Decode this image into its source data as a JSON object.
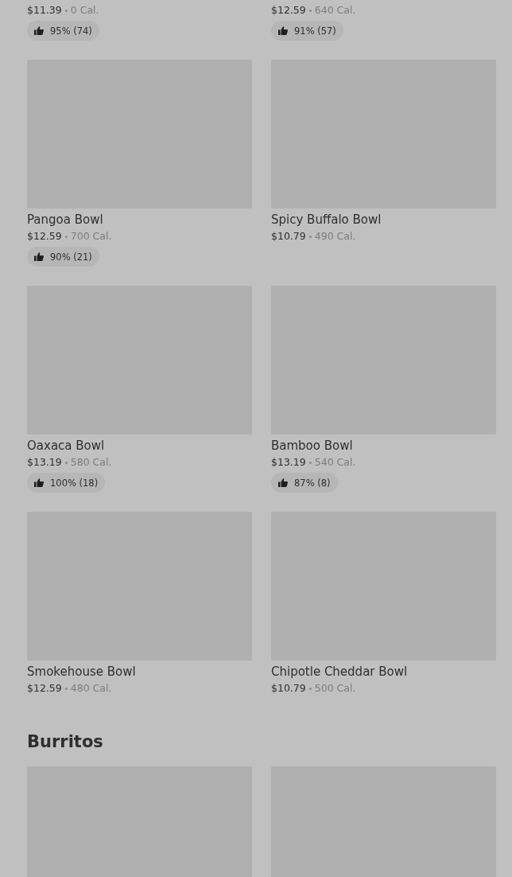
{
  "sections": [
    {
      "items": [
        {
          "image": false,
          "price": "$11.39",
          "calories": "0 Cal.",
          "rating": "95% (74)"
        },
        {
          "image": false,
          "price": "$12.59",
          "calories": "640 Cal.",
          "rating": "91% (57)"
        },
        {
          "image": true,
          "name": "Pangoa Bowl",
          "price": "$12.59",
          "calories": "700 Cal.",
          "rating": "90% (21)"
        },
        {
          "image": true,
          "name": "Spicy Buffalo Bowl",
          "price": "$10.79",
          "calories": "490 Cal."
        },
        {
          "image": true,
          "name": "Oaxaca Bowl",
          "price": "$13.19",
          "calories": "580 Cal.",
          "rating": "100% (18)"
        },
        {
          "image": true,
          "name": "Bamboo Bowl",
          "price": "$13.19",
          "calories": "540 Cal.",
          "rating": "87% (8)"
        },
        {
          "image": true,
          "name": "Smokehouse Bowl",
          "price": "$12.59",
          "calories": "480 Cal."
        },
        {
          "image": true,
          "name": "Chipotle Cheddar Bowl",
          "price": "$10.79",
          "calories": "500 Cal."
        }
      ]
    },
    {
      "title": "Burritos",
      "items": [
        {
          "image": true
        },
        {
          "image": true
        }
      ]
    }
  ]
}
